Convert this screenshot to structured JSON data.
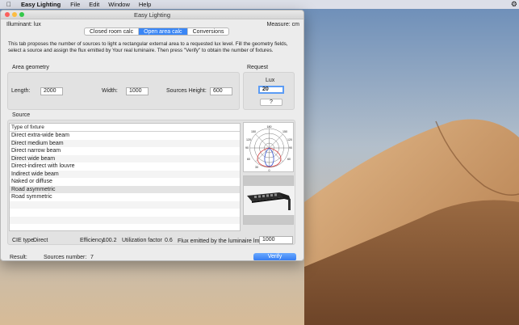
{
  "menubar": {
    "app_name": "Easy Lighting",
    "items": [
      "File",
      "Edit",
      "Window",
      "Help"
    ]
  },
  "window": {
    "title": "Easy Lighting",
    "illuminant": "Illuminant: lux",
    "measure": "Measure: cm"
  },
  "tabs": [
    {
      "label": "Closed room calc",
      "active": false
    },
    {
      "label": "Open area calc",
      "active": true
    },
    {
      "label": "Conversions",
      "active": false
    }
  ],
  "description": "This tab proposes the number of sources to light a rectangular external area to a requested lux level. Fill the geometry fields, select a source and assign the flux emitted by Your real luminaire. Then press \"Verify\" to obtain the number of fixtures.",
  "geometry": {
    "title": "Area geometry",
    "length_label": "Length:",
    "length_value": "2000",
    "width_label": "Width:",
    "width_value": "1000",
    "height_label": "Sources Height:",
    "height_value": "600"
  },
  "request": {
    "title": "Request",
    "lux_label": "Lux",
    "lux_value": "20",
    "help_label": "?"
  },
  "source": {
    "title": "Source",
    "column_header": "Type of fixture",
    "fixtures": [
      "Direct extra-wide beam",
      "Direct medium beam",
      "Direct narrow beam",
      "Direct wide beam",
      "Direct-indirect with louvre",
      "Indirect wide beam",
      "Naked or diffuse",
      "Road asymmetric",
      "Road symmetric"
    ],
    "selected_index": 7,
    "cie_label": "CIE type",
    "cie_value": "Direct",
    "efficiency_label": "Efficiency",
    "efficiency_value": "100.2",
    "utilization_label": "Utilization factor",
    "utilization_value": "0.6",
    "flux_label": "Flux emitted by the luminaire lm:",
    "flux_value": "1000"
  },
  "polar_labels": [
    "180",
    "150",
    "120",
    "90",
    "60",
    "30",
    "0",
    "150",
    "120",
    "90",
    "60"
  ],
  "result": {
    "label": "Result:",
    "sources_label": "Sources number:",
    "sources_value": "7",
    "verify_label": "Verify"
  },
  "colors": {
    "accent": "#3a86f5",
    "polar_red": "#d23a3a",
    "polar_blue": "#2f4fd0"
  }
}
